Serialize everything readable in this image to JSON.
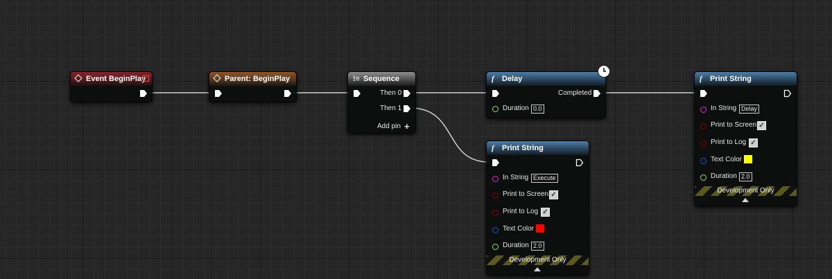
{
  "nodes": {
    "event_begin_play": {
      "title": "Event BeginPlay"
    },
    "parent_begin_play": {
      "title": "Parent: BeginPlay"
    },
    "sequence": {
      "title": "Sequence",
      "then0": "Then 0",
      "then1": "Then 1",
      "add_pin": "Add pin"
    },
    "delay": {
      "title": "Delay",
      "completed": "Completed",
      "duration_label": "Duration",
      "duration_value": "0.0"
    },
    "print_string_bottom": {
      "title": "Print String",
      "in_string_label": "In String",
      "in_string_value": "Execute",
      "print_to_screen_label": "Print to Screen",
      "print_to_log_label": "Print to Log",
      "text_color_label": "Text Color",
      "text_color": "#ff0000",
      "duration_label": "Duration",
      "duration_value": "2.0",
      "dev_only": "Development Only"
    },
    "print_string_right": {
      "title": "Print String",
      "in_string_label": "In String",
      "in_string_value": "Delay",
      "print_to_screen_label": "Print to Screen",
      "print_to_log_label": "Print to Log",
      "text_color_label": "Text Color",
      "text_color": "#ffff00",
      "duration_label": "Duration",
      "duration_value": "2.0",
      "dev_only": "Development Only"
    }
  },
  "icons": {
    "function": "f",
    "check": "✓",
    "plus": "+"
  },
  "colors": {
    "string_pin": "#e91fd2",
    "bool_pin": "#8f0000",
    "struct_pin": "#0a5ad6",
    "float_pin": "#97e05a",
    "wire": "#d8d8d8"
  }
}
